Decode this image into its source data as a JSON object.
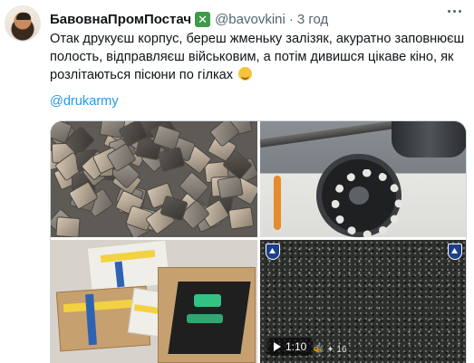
{
  "author": {
    "name": "БавовнаПромПостач",
    "handle": "@bavovkini",
    "separator": "·",
    "time": "3 год",
    "badge_glyph": "✕",
    "badge_color": "#3e9a4c"
  },
  "tweet": {
    "text_lines": [
      "Отак друкуєш корпус, береш жменьку залізяк, акуратно заповнюєш",
      "полость, відправляєш військовим, а потім дивишся цікаве кіно, як",
      "розлітаються пісюни по гілках"
    ],
    "hashtag": "@drukarmy"
  },
  "media": {
    "items": [
      "image-metal-plates",
      "image-cylinder-filled",
      "image-packed-boxes",
      "video-drone-footage"
    ],
    "video": {
      "duration": "1:10",
      "watermark": "🐝 ✦ 16"
    }
  },
  "colors": {
    "link": "#1d9bf0",
    "secondary_text": "#536471"
  }
}
